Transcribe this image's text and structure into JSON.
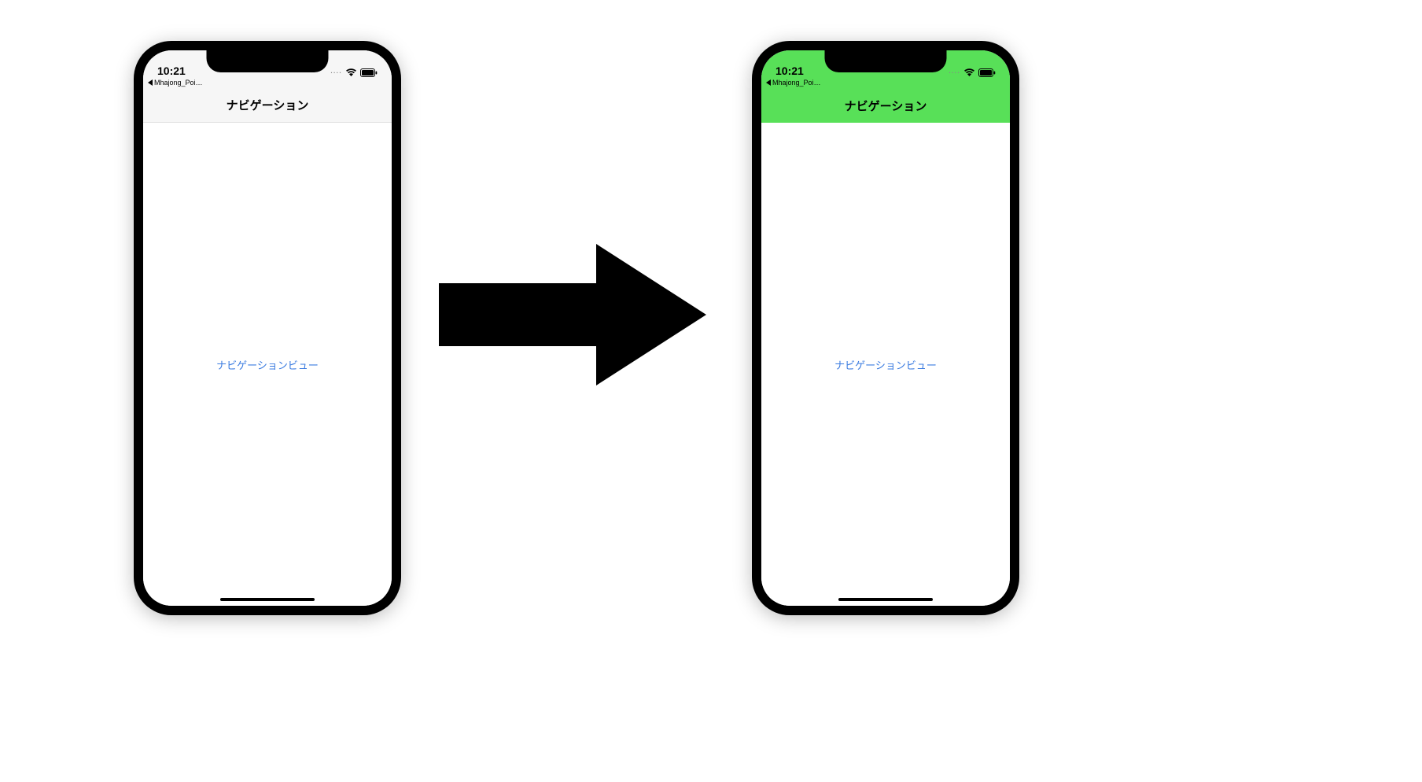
{
  "status": {
    "time": "10:21",
    "breadcrumb": "Mhajong_Poi…",
    "signal_dots": "····"
  },
  "phone_left": {
    "nav_title": "ナビゲーション",
    "content_text": "ナビゲーションビュー",
    "nav_background": "default"
  },
  "phone_right": {
    "nav_title": "ナビゲーション",
    "content_text": "ナビゲーションビュー",
    "nav_background": "green"
  },
  "colors": {
    "green": "#58e058",
    "link_blue": "#3a7be0"
  }
}
